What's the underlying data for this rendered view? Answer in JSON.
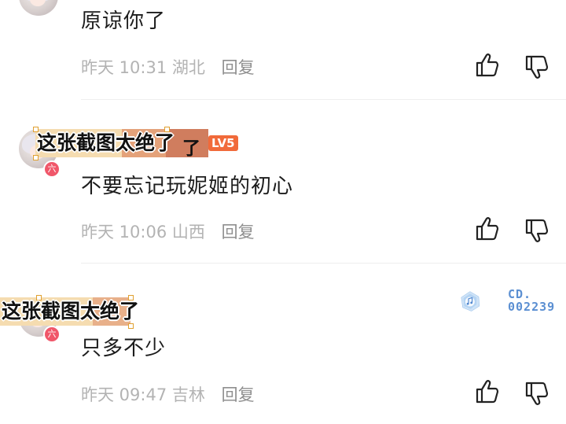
{
  "comments": [
    {
      "text": "原谅你了",
      "time": "昨天 10:31",
      "location": "湖北",
      "reply_label": "回复"
    },
    {
      "username": "了",
      "level": "LV5",
      "badge": "六",
      "overlay_caption": "这张截图太绝了",
      "text": "不要忘记玩妮姬的初心",
      "time": "昨天 10:06",
      "location": "山西",
      "reply_label": "回复"
    },
    {
      "badge": "六",
      "overlay_caption": "这张截图太绝了",
      "text": "只多不少",
      "time": "昨天 09:47",
      "location": "吉林",
      "reply_label": "回复"
    }
  ],
  "watermark": {
    "line1": "CD.",
    "line2": "002239"
  },
  "icons": {
    "like": "thumbs-up-icon",
    "dislike": "thumbs-down-icon"
  },
  "colors": {
    "text": "#1c1c1c",
    "meta": "#b3b3b3",
    "level_badge": "#f16a3a",
    "user_badge": "#f0576a",
    "watermark": "#5b8fd2"
  }
}
